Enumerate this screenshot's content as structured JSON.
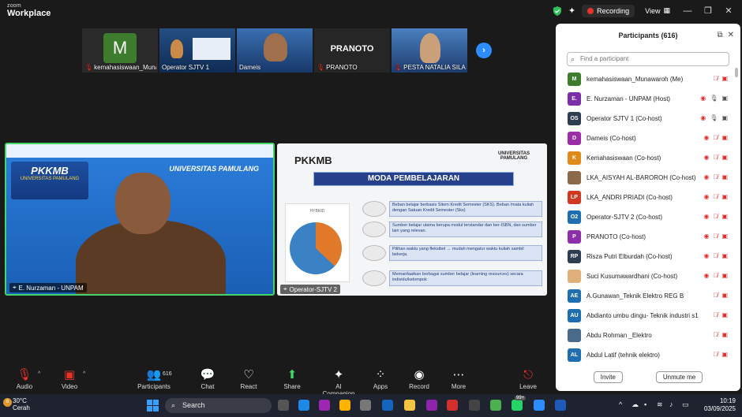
{
  "app": {
    "brand_top": "zoom",
    "brand_bottom": "Workplace"
  },
  "titlebar": {
    "recording_label": "Recording",
    "view_label": "View"
  },
  "thumbnails": [
    {
      "name": "kemahasiswaan_Muna...",
      "avatar_letter": "M"
    },
    {
      "name": "Operator SJTV 1"
    },
    {
      "name": "Dameis"
    },
    {
      "name": "PRANOTO",
      "display_text": "PRANOTO"
    },
    {
      "name": "PESTA NATALIA SILAB..."
    }
  ],
  "speaker_tile": {
    "label": "E. Nurzaman - UNPAM",
    "banner_title": "PKKMB",
    "banner_sub": "UNIVERSITAS PAMULANG",
    "univ_text": "UNIVERSITAS PAMULANG"
  },
  "share_tile": {
    "label": "Operator-SJTV 2",
    "slide_title": "PKKMB",
    "section": "MODA PEMBELAJARAN",
    "univ": "UNIVERSITAS PAMULANG",
    "chart_legend": "HYBRID",
    "rows": [
      "Beban belajar berbasis Sitem Kredit Semester (SKS). Beban /mata kuliah dengan Satuan Kredit Semester (Sks)",
      "Sumber belajar utama berupa modul terstandar dan ber-ISBN, dan sumber lain yang relevan.",
      "Pilihan waktu yang fleksibel → mudah mengatur waktu kuliah sambil bekerja.",
      "Memanfaatkan berbagai sumber belajar (learning resources) secara individu/kelompok"
    ]
  },
  "panel": {
    "title": "Participants (616)",
    "search_placeholder": "Find a participant",
    "invite_label": "Invite",
    "unmute_label": "Unmute me",
    "participants": [
      {
        "name": "kemahasiswaan_Munawaroh (Me)",
        "initials": "M",
        "color": "#3f7d2e",
        "mic": "off",
        "video": "off",
        "rec": false
      },
      {
        "name": "E. Nurzaman - UNPAM (Host)",
        "initials": "E.",
        "color": "#7b2ea8",
        "mic": "on",
        "video": "on",
        "rec": true
      },
      {
        "name": "Operator SJTV 1 (Co-host)",
        "initials": "OS",
        "color": "#2c3e50",
        "mic": "on",
        "video": "on",
        "rec": true
      },
      {
        "name": "Dameis (Co-host)",
        "initials": "D",
        "color": "#9b2ea8",
        "mic": "off",
        "video": "off",
        "rec": true
      },
      {
        "name": "Kemahasiswaan (Co-host)",
        "initials": "K",
        "color": "#e08a1a",
        "mic": "off",
        "video": "off",
        "rec": true
      },
      {
        "name": "LKA_AISYAH AL-BAROROH (Co-host)",
        "initials": "",
        "color": "#8a6a4a",
        "mic": "off",
        "video": "off",
        "rec": true
      },
      {
        "name": "LKA_ANDRI PRIADI (Co-host)",
        "initials": "LP",
        "color": "#d0391f",
        "mic": "off",
        "video": "off",
        "rec": true
      },
      {
        "name": "Operator-SJTV 2 (Co-host)",
        "initials": "O2",
        "color": "#1f6fb0",
        "mic": "off",
        "video": "off",
        "rec": true
      },
      {
        "name": "PRANOTO (Co-host)",
        "initials": "P",
        "color": "#8e2ea8",
        "mic": "off",
        "video": "off",
        "rec": true
      },
      {
        "name": "Risza Putri Elburdah (Co-host)",
        "initials": "RP",
        "color": "#2c3e50",
        "mic": "off",
        "video": "off",
        "rec": true
      },
      {
        "name": "Suci Kusumawardhani (Co-host)",
        "initials": "",
        "color": "#e0b07a",
        "mic": "off",
        "video": "off",
        "rec": true
      },
      {
        "name": "A.Gunawan_Teknik Elektro REG B",
        "initials": "AE",
        "color": "#1f6fb0",
        "mic": "off",
        "video": "off",
        "rec": false
      },
      {
        "name": "Abdianto umbu dingu- Teknik industri s1",
        "initials": "AU",
        "color": "#1f6fb0",
        "mic": "off",
        "video": "off",
        "rec": false
      },
      {
        "name": "Abdu Rohman _Elektro",
        "initials": "",
        "color": "#4a6a8a",
        "mic": "off",
        "video": "off",
        "rec": false
      },
      {
        "name": "Abdul Latif (tehnik elektro)",
        "initials": "AL",
        "color": "#1f6fb0",
        "mic": "off",
        "video": "off",
        "rec": false
      }
    ]
  },
  "controls": {
    "audio": "Audio",
    "video": "Video",
    "participants": "Participants",
    "participants_count": "616",
    "chat": "Chat",
    "react": "React",
    "share": "Share",
    "ai": "AI Companion",
    "apps": "Apps",
    "record": "Record",
    "more": "More",
    "leave": "Leave"
  },
  "taskbar": {
    "temp": "30°C",
    "weather": "Cerah",
    "weather_badge": "6",
    "search": "Search",
    "time": "10:19",
    "date": "03/09/2025",
    "badge": "99+"
  }
}
